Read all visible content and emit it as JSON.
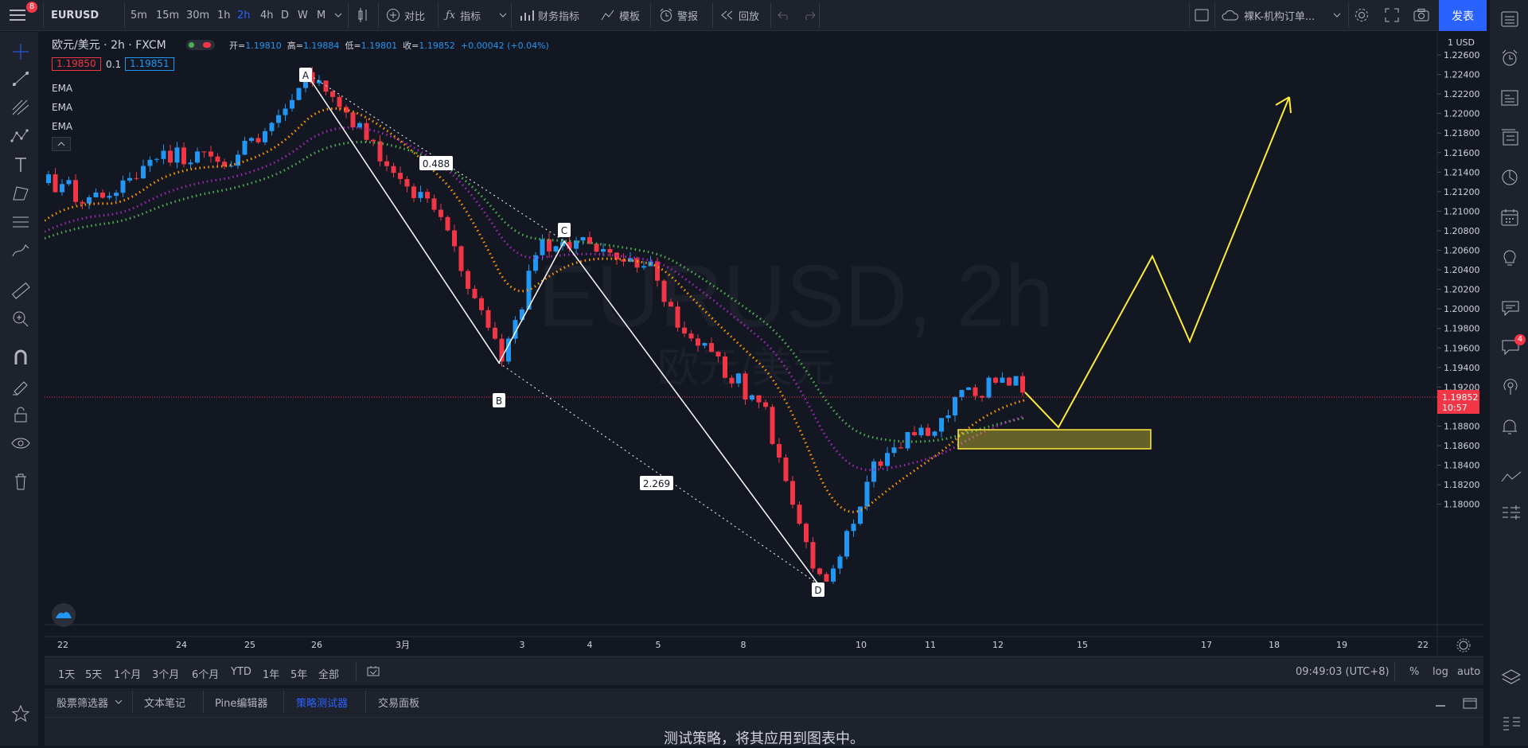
{
  "toolbar": {
    "symbol": "EURUSD",
    "intervals": [
      "5m",
      "15m",
      "30m",
      "1h",
      "2h",
      "4h",
      "D",
      "W",
      "M"
    ],
    "active_interval": "2h",
    "compare": "对比",
    "indicators": "指标",
    "financials": "财务指标",
    "templates": "模板",
    "alert": "警报",
    "replay": "回放",
    "layout_name": "裸K-机构订单...",
    "publish": "发表",
    "menu_badge": "8"
  },
  "legend": {
    "title": "欧元/美元",
    "interval": "2h",
    "source": "FXCM",
    "open_label": "开=",
    "open": "1.19810",
    "high_label": "高=",
    "high": "1.19884",
    "low_label": "低=",
    "low": "1.19801",
    "close_label": "收=",
    "close": "1.19852",
    "change": "+0.00042 (+0.04%)",
    "bid": "1.19850",
    "spread": "0.1",
    "ask": "1.19851",
    "indicators": [
      "EMA",
      "EMA",
      "EMA"
    ]
  },
  "watermark": {
    "symbol": "EURUSD, 2h",
    "name": "欧元/美元"
  },
  "price_axis": {
    "currency": "1 USD",
    "ticks": [
      "1.22600",
      "1.22400",
      "1.22200",
      "1.22000",
      "1.21800",
      "1.21600",
      "1.21400",
      "1.21200",
      "1.21000",
      "1.20800",
      "1.20600",
      "1.20400",
      "1.20200",
      "1.20000",
      "1.19800",
      "1.19600",
      "1.19400",
      "1.19200",
      "1.19000",
      "1.18800",
      "1.18600",
      "1.18400",
      "1.18200",
      "1.18000"
    ],
    "last_price": "1.19852",
    "countdown": "10:57"
  },
  "time_axis": {
    "ticks": [
      "22",
      "24",
      "25",
      "26",
      "3月",
      "3",
      "4",
      "5",
      "8",
      "10",
      "11",
      "12",
      "15",
      "17",
      "18",
      "19",
      "22"
    ]
  },
  "pattern": {
    "points": {
      "A": "A",
      "B": "B",
      "C": "C",
      "D": "D"
    },
    "ratio_ac": "0.488",
    "ratio_bd": "2.269"
  },
  "colors": {
    "up": "#2196f3",
    "down": "#f23645",
    "ema_fast": "#ff9800",
    "ema_mid": "#9c27b0",
    "ema_slow": "#4caf50",
    "projection": "#ffeb3b",
    "accent": "#2962ff"
  },
  "ranges": [
    "1天",
    "5天",
    "1个月",
    "3个月",
    "6个月",
    "YTD",
    "1年",
    "5年",
    "全部"
  ],
  "clock": "09:49:03 (UTC+8)",
  "scale_opts": [
    "%",
    "log",
    "auto"
  ],
  "bottom_tabs": [
    "股票筛选器",
    "文本笔记",
    "Pine编辑器",
    "策略测试器",
    "交易面板"
  ],
  "active_tab": "策略测试器",
  "strategy_message": "测试策略，将其应用到图表中。",
  "right_badge": "4"
}
